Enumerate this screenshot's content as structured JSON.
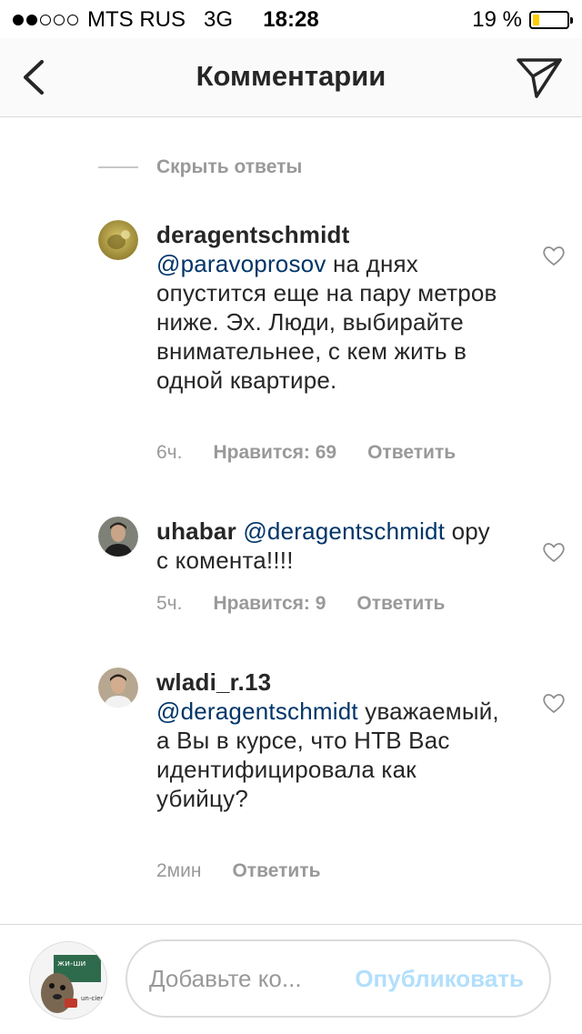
{
  "status_bar": {
    "carrier": "MTS RUS",
    "network": "3G",
    "time": "18:28",
    "battery_percent": "19 %",
    "battery_level": 0.19,
    "signal_bars": 2,
    "battery_color": "#ffcc00"
  },
  "nav": {
    "title": "Комментарии",
    "back_icon": "chevron-left-icon",
    "send_icon": "paper-plane-icon"
  },
  "hide_replies": "Скрыть ответы",
  "comments": [
    {
      "username": "deragentschmidt",
      "mention": "@paravoprosov",
      "text": " на днях опустится еще на пару метров ниже. Эх. Люди, выбирайте внимательнее, с кем жить в одной квартире.",
      "time": "6ч.",
      "likes": "Нравится: 69",
      "reply": "Ответить"
    },
    {
      "username": "uhabar",
      "mention": "@deragentschmidt",
      "text": " ору с комента!!!!",
      "time": "5ч.",
      "likes": "Нравится: 9",
      "reply": "Ответить"
    },
    {
      "username": "wladi_r.13",
      "mention": "@deragentschmidt",
      "text": " уважаемый, а Вы в курсе, что НТВ Вас идентифицировала как убийцу?",
      "time": "2мин",
      "reply": "Ответить"
    }
  ],
  "composer": {
    "placeholder": "Добавьте ко...",
    "post_label": "Опубликовать",
    "post_color": "#b2dffc",
    "avatar_text_top": "жи-ши",
    "avatar_text_bottom": "un-cied-re"
  },
  "colors": {
    "mention": "#003569",
    "meta": "#999999",
    "text": "#262626"
  }
}
